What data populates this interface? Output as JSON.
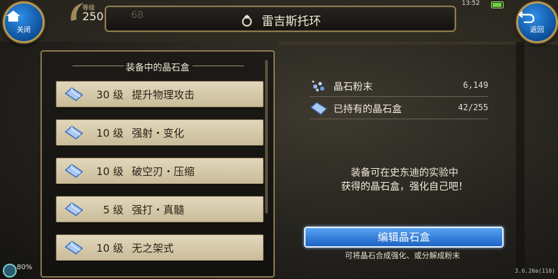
{
  "header": {
    "title": "雷吉斯托环",
    "close_label": "关闭",
    "back_label": "返回",
    "level_label": "等级",
    "level_value": "250",
    "level_background_value": "68",
    "clock": "13:52"
  },
  "left_panel": {
    "title": "装备中的晶石盒",
    "slots": [
      {
        "level": "30 级",
        "name": "提升物理攻击"
      },
      {
        "level": "10 级",
        "name": "强射・变化"
      },
      {
        "level": "10 级",
        "name": "破空刃・压缩"
      },
      {
        "level": "5 级",
        "name": "强打・真髓"
      },
      {
        "level": "10 级",
        "name": "无之架式"
      }
    ]
  },
  "resources": {
    "powder_label": "晶石粉末",
    "powder_value": "6,149",
    "boxes_label": "已持有的晶石盒",
    "boxes_value": "42/255"
  },
  "description_line1": "装备可在史东迪的实验中",
  "description_line2": "获得的晶石盒，强化自己吧！",
  "edit_button": "编辑晶石盒",
  "edit_hint": "可将晶石合成强化、或分解成粉末",
  "footer": {
    "status_percent": "80%",
    "version": "3.6.20a(110)"
  },
  "colors": {
    "accent_blue": "#1c63c4",
    "frame_gold": "#8c7a4f",
    "slot_beige": "#d9cdb0"
  }
}
